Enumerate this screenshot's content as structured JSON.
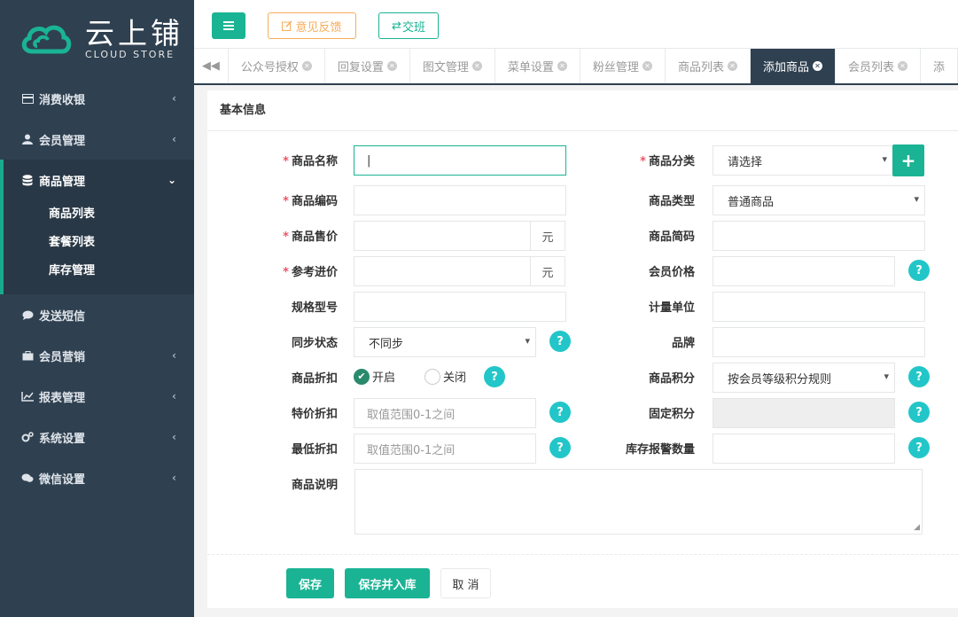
{
  "logo": {
    "cn": "云上铺",
    "en": "CLOUD STORE"
  },
  "sidebar": {
    "items": [
      {
        "label": "消费收银",
        "icon": "card-icon"
      },
      {
        "label": "会员管理",
        "icon": "user-icon"
      },
      {
        "label": "商品管理",
        "icon": "database-icon",
        "expanded": true,
        "children": [
          "商品列表",
          "套餐列表",
          "库存管理"
        ]
      },
      {
        "label": "发送短信",
        "icon": "comment-icon"
      },
      {
        "label": "会员营销",
        "icon": "briefcase-icon"
      },
      {
        "label": "报表管理",
        "icon": "chart-icon"
      },
      {
        "label": "系统设置",
        "icon": "cogs-icon"
      },
      {
        "label": "微信设置",
        "icon": "comments-icon"
      }
    ]
  },
  "topbar": {
    "feedback": "意见反馈",
    "shift": "交班"
  },
  "tabs": [
    "公众号授权",
    "回复设置",
    "图文管理",
    "菜单设置",
    "粉丝管理",
    "商品列表",
    "添加商品",
    "会员列表",
    "添"
  ],
  "active_tab": "添加商品",
  "form": {
    "section_title": "基本信息",
    "name_label": "商品名称",
    "category_label": "商品分类",
    "category_value": "请选择",
    "code_label": "商品编码",
    "type_label": "商品类型",
    "type_value": "普通商品",
    "price_label": "商品售价",
    "unit_yuan": "元",
    "short_code_label": "商品简码",
    "ref_price_label": "参考进价",
    "member_price_label": "会员价格",
    "spec_label": "规格型号",
    "measure_unit_label": "计量单位",
    "sync_label": "同步状态",
    "sync_value": "不同步",
    "brand_label": "品牌",
    "discount_label": "商品折扣",
    "discount_on": "开启",
    "discount_off": "关闭",
    "points_label": "商品积分",
    "points_value": "按会员等级积分规则",
    "special_discount_label": "特价折扣",
    "special_discount_placeholder": "取值范围0-1之间",
    "fixed_points_label": "固定积分",
    "min_discount_label": "最低折扣",
    "min_discount_placeholder": "取值范围0-1之间",
    "stock_alert_label": "库存报警数量",
    "desc_label": "商品说明",
    "help": "?",
    "required_mark": "*"
  },
  "buttons": {
    "save": "保存",
    "save_stock": "保存并入库",
    "cancel": "取 消"
  },
  "colors": {
    "primary": "#1ab394",
    "sidebar": "#2f4050",
    "warning": "#f8ac59",
    "info": "#23c6c8",
    "required": "#ed5565"
  }
}
